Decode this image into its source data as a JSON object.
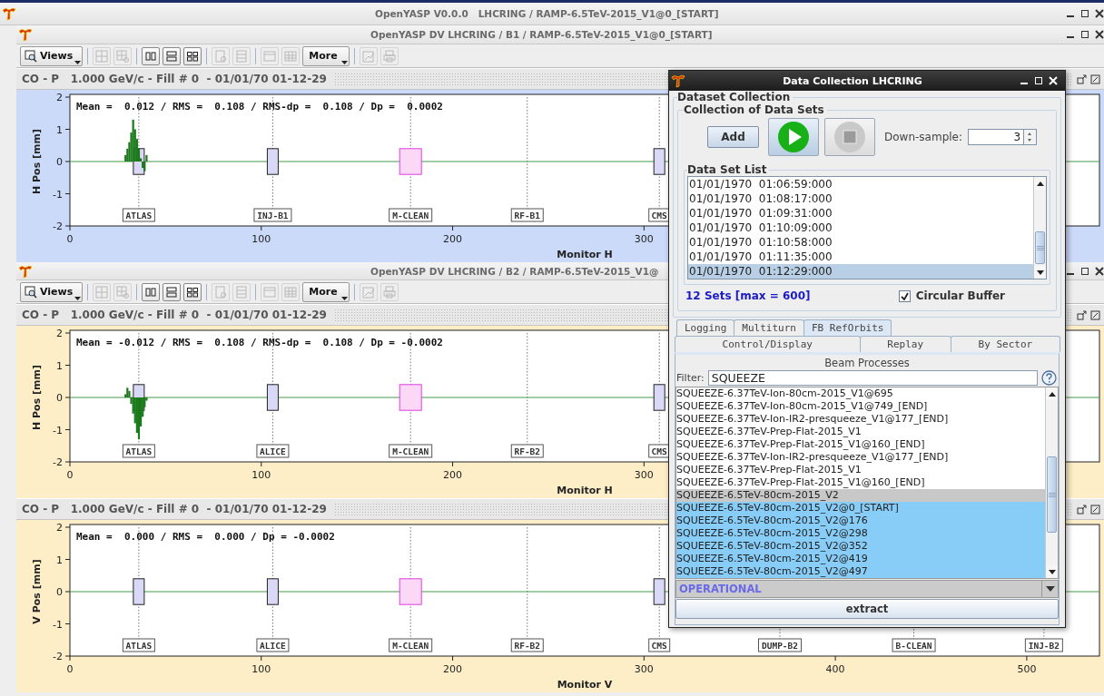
{
  "window": {
    "title": "OpenYASP V0.0.0   LHCRING / RAMP-6.5TeV-2015_V1@0_[START]"
  },
  "frames": [
    {
      "title": "OpenYASP DV LHCRING / B1 / RAMP-6.5TeV-2015_V1@0_[START]",
      "toolbar": {
        "views": "Views",
        "more": "More",
        "tools": [
          {
            "kind": "grid",
            "disabled": true
          },
          {
            "kind": "grid-zoom",
            "disabled": true
          },
          {
            "kind": "columns",
            "disabled": false
          },
          {
            "kind": "rows",
            "disabled": false
          },
          {
            "kind": "quad",
            "disabled": false
          },
          {
            "kind": "doc",
            "disabled": true
          },
          {
            "kind": "list",
            "disabled": true
          },
          {
            "kind": "window",
            "disabled": true
          },
          {
            "kind": "table",
            "disabled": true
          },
          {
            "kind": "export",
            "disabled": true
          },
          {
            "kind": "print",
            "disabled": true
          }
        ]
      },
      "panels": [
        {
          "header": "CO - P   1.000 GeV/c - Fill # 0  - 01/01/70 01-12-29",
          "color": "#cbdaf8",
          "stats": "Mean =  0.012 / RMS =  0.108 / RMS-dp =  0.108 / Dp =  0.0002",
          "monitors": [
            {
              "label": "ATLAS",
              "kind": "box"
            },
            {
              "label": "INJ-B1",
              "kind": "box"
            },
            {
              "label": "M-CLEAN",
              "kind": "magenta-box"
            },
            {
              "label": "RF-B1",
              "kind": "label"
            },
            {
              "label": "CMS",
              "kind": "box"
            }
          ],
          "chart_data": {
            "type": "bar",
            "xlabel": "Monitor H",
            "ylabel": "H Pos [mm]",
            "xlim": [
              0,
              538
            ],
            "ylim": [
              -2,
              2
            ],
            "xticks": [
              0,
              100,
              200,
              300
            ],
            "yticks": [
              -2,
              -1,
              0,
              1,
              2
            ],
            "x": [
              29,
              30,
              31,
              32,
              33,
              34,
              35,
              36,
              37,
              38,
              39,
              40
            ],
            "series": [
              {
                "color": "#1a7a1a",
                "values": [
                  0.2,
                  0.4,
                  0.6,
                  0.9,
                  1.3,
                  1.0,
                  0.7,
                  0.4,
                  0.1,
                  -0.2,
                  -0.3,
                  0.2
                ]
              }
            ],
            "ref_lines": [
              {
                "axis": "y",
                "value": 0,
                "color": "#4a9a4a"
              }
            ]
          }
        }
      ]
    },
    {
      "title": "OpenYASP DV LHCRING / B2 / RAMP-6.5TeV-2015_V1@",
      "toolbar": {
        "views": "Views",
        "more": "More",
        "tools": [
          {
            "kind": "grid",
            "disabled": true
          },
          {
            "kind": "grid-zoom",
            "disabled": true
          },
          {
            "kind": "columns",
            "disabled": false
          },
          {
            "kind": "rows",
            "disabled": false
          },
          {
            "kind": "quad",
            "disabled": false
          },
          {
            "kind": "doc",
            "disabled": true
          },
          {
            "kind": "list",
            "disabled": true
          },
          {
            "kind": "window",
            "disabled": true
          },
          {
            "kind": "table",
            "disabled": true
          },
          {
            "kind": "export",
            "disabled": true
          },
          {
            "kind": "print",
            "disabled": true
          }
        ]
      },
      "panels": [
        {
          "header": "CO - P   1.000 GeV/c - Fill # 0  - 01/01/70 01-12-29",
          "color": "#fdeec8",
          "stats": "Mean = -0.012 / RMS =  0.108 / RMS-dp =  0.108 / Dp = -0.0002",
          "monitors": [
            {
              "label": "ATLAS",
              "kind": "box"
            },
            {
              "label": "ALICE",
              "kind": "box"
            },
            {
              "label": "M-CLEAN",
              "kind": "magenta-box"
            },
            {
              "label": "RF-B2",
              "kind": "label"
            },
            {
              "label": "CMS",
              "kind": "box"
            }
          ],
          "chart_data": {
            "type": "bar",
            "xlabel": "Monitor H",
            "ylabel": "H Pos [mm]",
            "xlim": [
              0,
              538
            ],
            "ylim": [
              -2,
              2
            ],
            "xticks": [
              0,
              100,
              200,
              300
            ],
            "yticks": [
              -2,
              -1,
              0,
              1,
              2
            ],
            "x": [
              29,
              30,
              31,
              32,
              33,
              34,
              35,
              36,
              37,
              38,
              39,
              40
            ],
            "series": [
              {
                "color": "#1a7a1a",
                "values": [
                  0.1,
                  0.3,
                  0.2,
                  -0.2,
                  -0.5,
                  -0.8,
                  -1.1,
                  -1.3,
                  -0.9,
                  -0.6,
                  -0.3,
                  -0.1
                ]
              }
            ],
            "ref_lines": [
              {
                "axis": "y",
                "value": 0,
                "color": "#4a9a4a"
              }
            ]
          }
        },
        {
          "header": "CO - P   1.000 GeV/c - Fill # 0  - 01/01/70 01-12-29",
          "color": "#fdeec8",
          "stats": "Mean =  0.000 / RMS =  0.000 / Dp = -0.0002",
          "monitors": [
            {
              "label": "ATLAS",
              "kind": "box"
            },
            {
              "label": "ALICE",
              "kind": "box"
            },
            {
              "label": "M-CLEAN",
              "kind": "magenta-box"
            },
            {
              "label": "RF-B2",
              "kind": "label"
            },
            {
              "label": "CMS",
              "kind": "box"
            },
            {
              "label": "DUMP-B2",
              "kind": "label"
            },
            {
              "label": "B-CLEAN",
              "kind": "label"
            },
            {
              "label": "INJ-B2",
              "kind": "label"
            }
          ],
          "chart_data": {
            "type": "bar",
            "xlabel": "Monitor V",
            "ylabel": "V Pos [mm]",
            "xlim": [
              0,
              538
            ],
            "ylim": [
              -2,
              2
            ],
            "xticks": [
              0,
              100,
              200,
              300,
              400,
              500
            ],
            "yticks": [
              -2,
              -1,
              0,
              1,
              2
            ],
            "ref_lines": [
              {
                "axis": "y",
                "value": 0,
                "color": "#4a9a4a"
              }
            ]
          }
        }
      ]
    }
  ],
  "dialog": {
    "title": "Data Collection LHCRING",
    "group": "Dataset Collection",
    "collection_title": "Collection of Data Sets",
    "add": "Add",
    "downsample_label": "Down-sample:",
    "downsample_value": "3",
    "list_title": "Data Set List",
    "datasets": [
      {
        "label": "01/01/1970  01:06:59:000",
        "selected": false
      },
      {
        "label": "01/01/1970  01:08:17:000",
        "selected": false
      },
      {
        "label": "01/01/1970  01:09:31:000",
        "selected": false
      },
      {
        "label": "01/01/1970  01:10:09:000",
        "selected": false
      },
      {
        "label": "01/01/1970  01:10:58:000",
        "selected": false
      },
      {
        "label": "01/01/1970  01:11:35:000",
        "selected": false
      },
      {
        "label": "01/01/1970  01:12:29:000",
        "selected": true
      }
    ],
    "count": "12 Sets [max = 600]",
    "circular_buffer": {
      "label": "Circular Buffer",
      "checked": true
    },
    "tabs_top": [
      {
        "label": "Logging",
        "selected": false
      },
      {
        "label": "Multiturn",
        "selected": false
      },
      {
        "label": "FB RefOrbits",
        "selected": true
      }
    ],
    "tabs_bottom": [
      {
        "label": "Control/Display",
        "selected": false
      },
      {
        "label": "Replay",
        "selected": false
      },
      {
        "label": "By Sector",
        "selected": false
      }
    ],
    "panel_title": "Beam Processes",
    "filter": {
      "label": "Filter:",
      "value": "SQUEEZE"
    },
    "processes": [
      {
        "label": "SQUEEZE-6.37TeV-Ion-80cm-2015_V1@695",
        "selected": false,
        "current": false
      },
      {
        "label": "SQUEEZE-6.37TeV-Ion-80cm-2015_V1@749_[END]",
        "selected": false,
        "current": false
      },
      {
        "label": "SQUEEZE-6.37TeV-Ion-IR2-presqueeze_V1@177_[END]",
        "selected": false,
        "current": false
      },
      {
        "label": "SQUEEZE-6.37TeV-Prep-Flat-2015_V1",
        "selected": false,
        "current": false
      },
      {
        "label": "SQUEEZE-6.37TeV-Prep-Flat-2015_V1@160_[END]",
        "selected": false,
        "current": false
      },
      {
        "label": "SQUEEZE-6.37TeV-Ion-IR2-presqueeze_V1@177_[END]",
        "selected": false,
        "current": false
      },
      {
        "label": "SQUEEZE-6.37TeV-Prep-Flat-2015_V1",
        "selected": false,
        "current": false
      },
      {
        "label": "SQUEEZE-6.37TeV-Prep-Flat-2015_V1@160_[END]",
        "selected": false,
        "current": false
      },
      {
        "label": "SQUEEZE-6.5TeV-80cm-2015_V2",
        "selected": false,
        "current": true
      },
      {
        "label": "SQUEEZE-6.5TeV-80cm-2015_V2@0_[START]",
        "selected": true,
        "current": false
      },
      {
        "label": "SQUEEZE-6.5TeV-80cm-2015_V2@176",
        "selected": true,
        "current": false
      },
      {
        "label": "SQUEEZE-6.5TeV-80cm-2015_V2@298",
        "selected": true,
        "current": false
      },
      {
        "label": "SQUEEZE-6.5TeV-80cm-2015_V2@352",
        "selected": true,
        "current": false
      },
      {
        "label": "SQUEEZE-6.5TeV-80cm-2015_V2@419",
        "selected": true,
        "current": false
      },
      {
        "label": "SQUEEZE-6.5TeV-80cm-2015_V2@497",
        "selected": true,
        "current": false
      }
    ],
    "mode": "OPERATIONAL",
    "extract": "extract"
  }
}
